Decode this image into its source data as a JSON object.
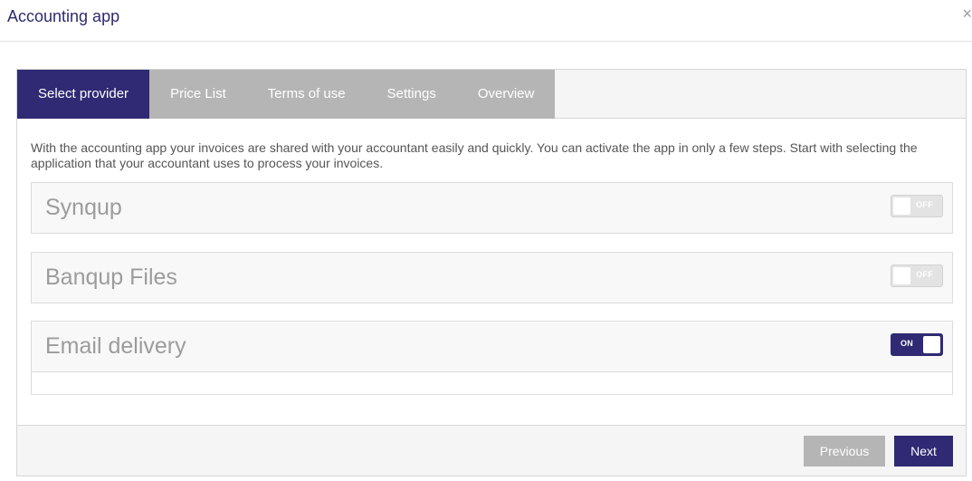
{
  "modal": {
    "title": "Accounting app",
    "close_glyph": "×"
  },
  "tabs": [
    {
      "label": "Select provider",
      "active": true
    },
    {
      "label": "Price List",
      "active": false
    },
    {
      "label": "Terms of use",
      "active": false
    },
    {
      "label": "Settings",
      "active": false
    },
    {
      "label": "Overview",
      "active": false
    }
  ],
  "intro": "With the accounting app your invoices are shared with your accountant easily and quickly. You can activate the app in only a few steps. Start with selecting the application that your accountant uses to process your invoices.",
  "providers": [
    {
      "name": "Synqup",
      "toggle": "OFF"
    },
    {
      "name": "Banqup Files",
      "toggle": "OFF"
    },
    {
      "name": "Email delivery",
      "toggle": "ON"
    }
  ],
  "footer": {
    "previous_label": "Previous",
    "next_label": "Next"
  },
  "colors": {
    "accent": "#2f2a73",
    "inactive": "#b5b5b5"
  }
}
